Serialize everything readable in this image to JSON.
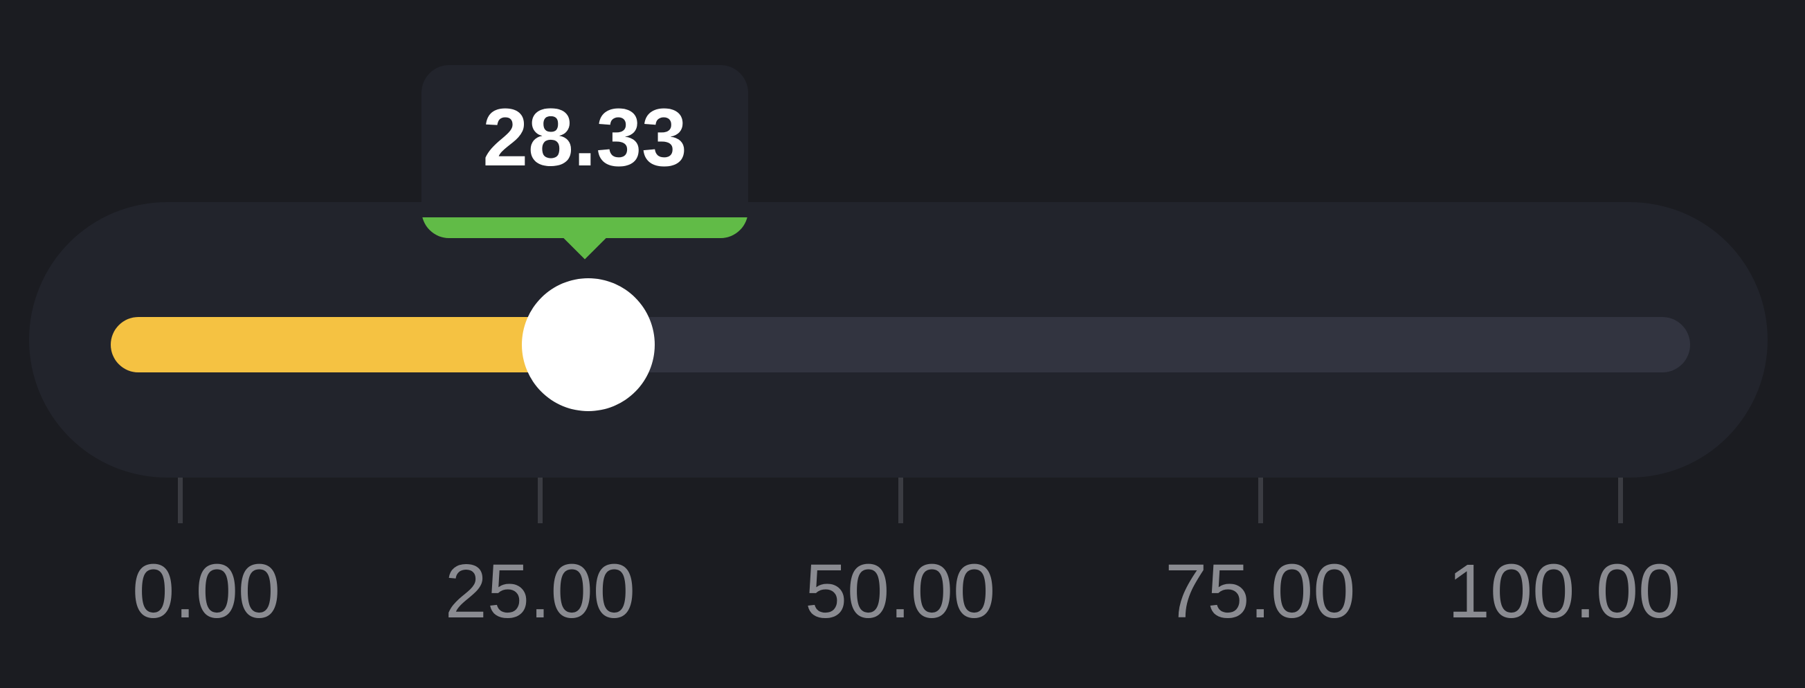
{
  "slider": {
    "value": 28.33,
    "value_label": "28.33",
    "min": 0,
    "max": 100,
    "ticks": [
      {
        "value": 0,
        "label": "0.00"
      },
      {
        "value": 25,
        "label": "25.00"
      },
      {
        "value": 50,
        "label": "50.00"
      },
      {
        "value": 75,
        "label": "75.00"
      },
      {
        "value": 100,
        "label": "100.00"
      }
    ]
  },
  "colors": {
    "background": "#1b1c21",
    "card": "#22242c",
    "track": "#323440",
    "fill": "#f5c242",
    "accent": "#61bb47",
    "thumb": "#ffffff",
    "tick_text": "#8a8b91"
  }
}
